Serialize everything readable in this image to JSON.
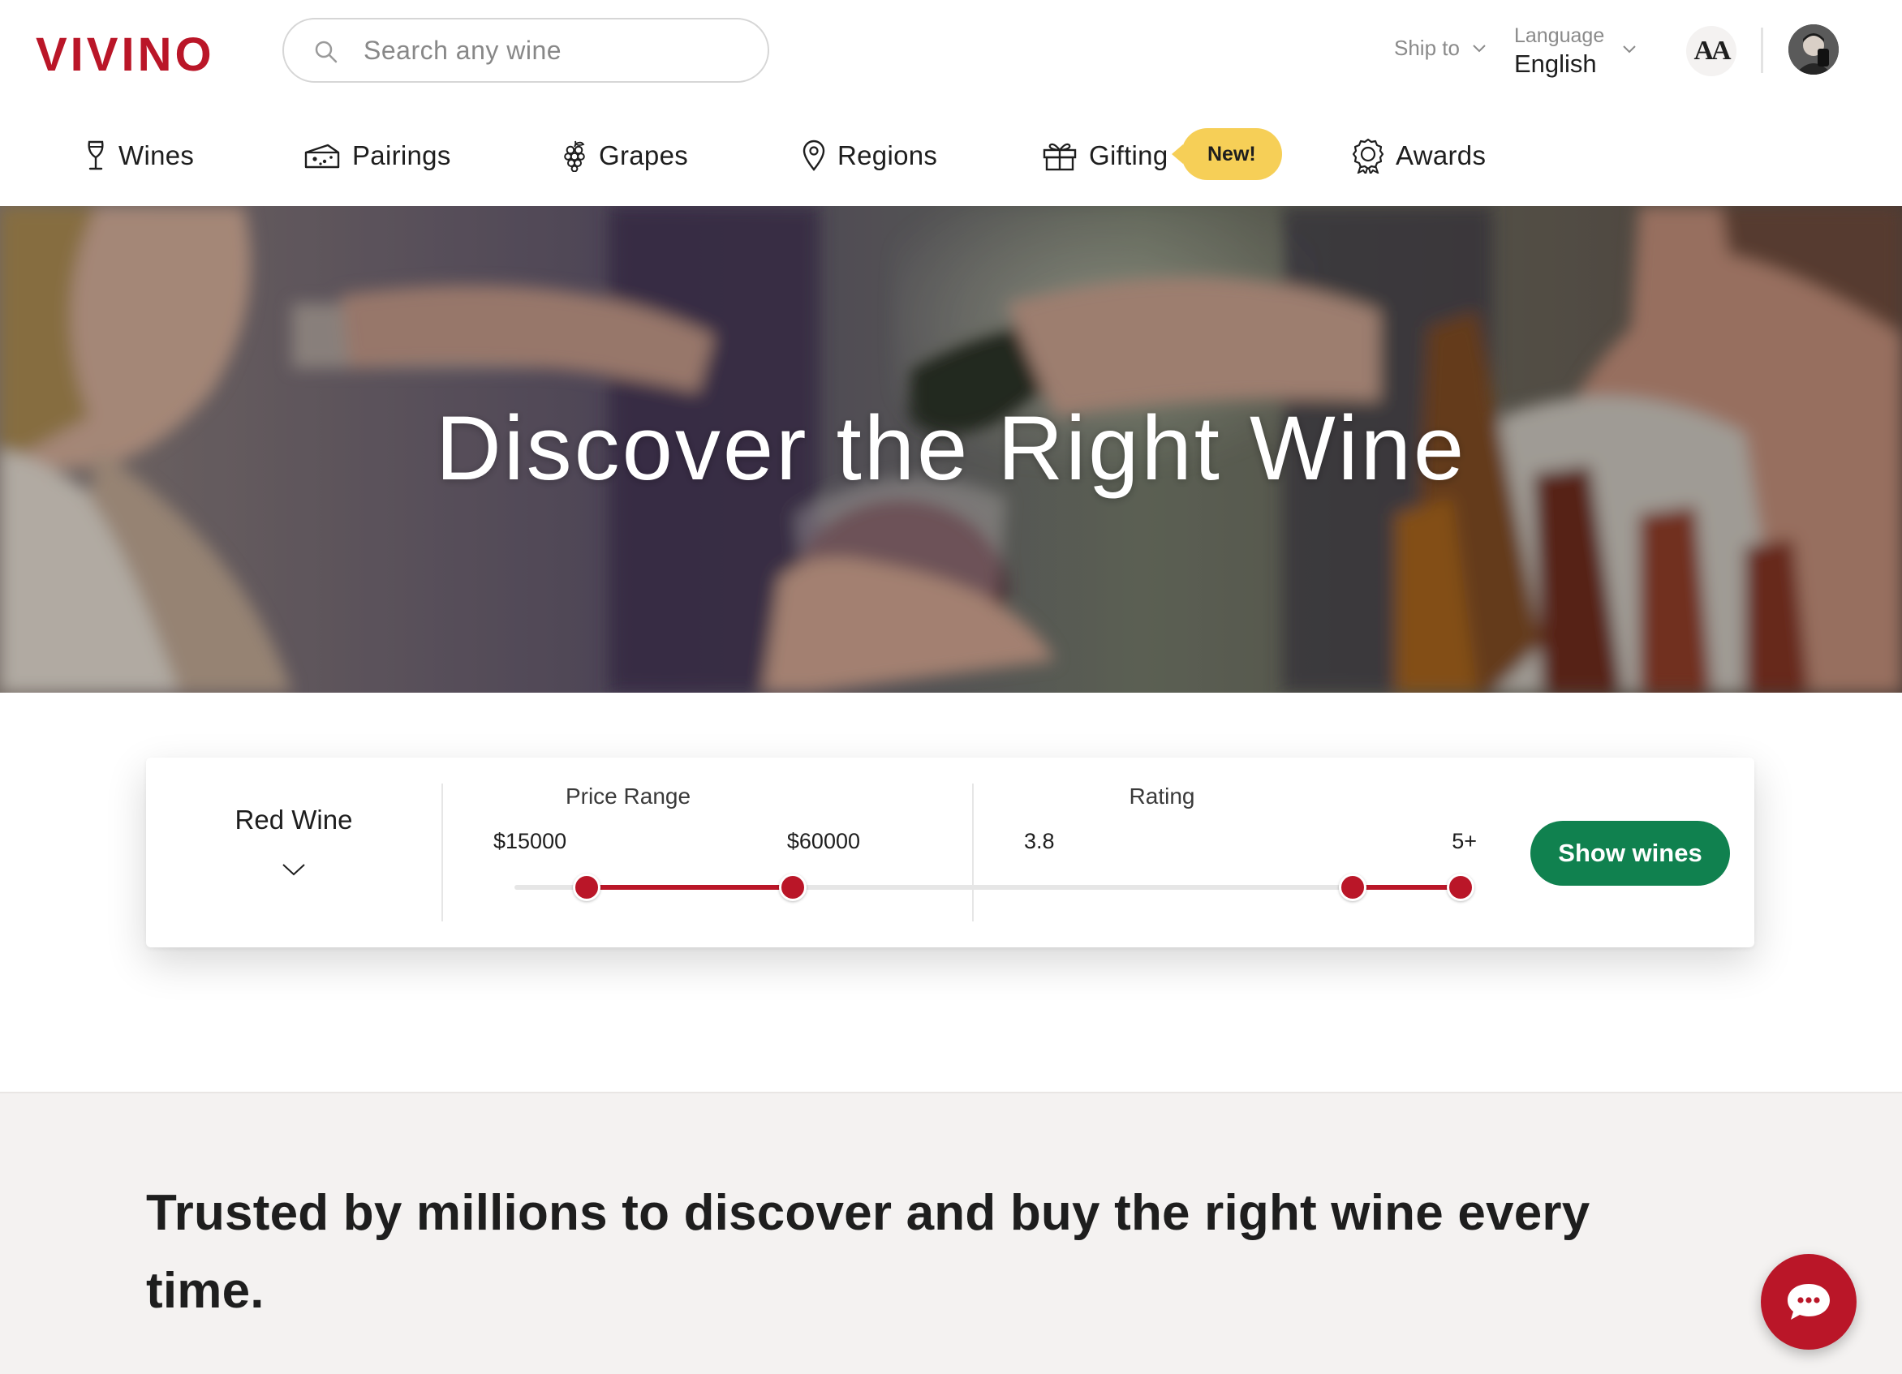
{
  "brand": {
    "logo_text": "VIVINO",
    "accent_color": "#ba1628",
    "button_color": "#10814f",
    "badge_color": "#f6cf57"
  },
  "search": {
    "placeholder": "Search any wine",
    "value": "",
    "icon": "search-icon"
  },
  "header": {
    "ship_to_label": "Ship to",
    "language_label": "Language",
    "language_value": "English",
    "text_size_button": "AA",
    "avatar": "user-avatar"
  },
  "nav": {
    "items": [
      {
        "label": "Wines",
        "icon": "wine-glass-icon"
      },
      {
        "label": "Pairings",
        "icon": "cheese-icon"
      },
      {
        "label": "Grapes",
        "icon": "grapes-icon"
      },
      {
        "label": "Regions",
        "icon": "map-pin-icon"
      },
      {
        "label": "Gifting",
        "icon": "gift-icon"
      },
      {
        "label": "Awards",
        "icon": "award-icon"
      }
    ],
    "gifting_badge": "New!"
  },
  "hero": {
    "title": "Discover the Right Wine"
  },
  "filter": {
    "wine_type": "Red Wine",
    "price": {
      "title": "Price Range",
      "min_label": "$15000",
      "max_label": "$60000",
      "low_fraction": 0.13,
      "high_fraction": 0.5
    },
    "rating": {
      "title": "Rating",
      "min_label": "3.8",
      "max_label": "5+",
      "low_fraction": 0.74,
      "high_fraction": 1.0
    },
    "button_label": "Show wines"
  },
  "lower": {
    "tagline": "Trusted by millions to discover and buy the right wine every time."
  },
  "chat": {
    "icon": "chat-bubble-icon"
  }
}
